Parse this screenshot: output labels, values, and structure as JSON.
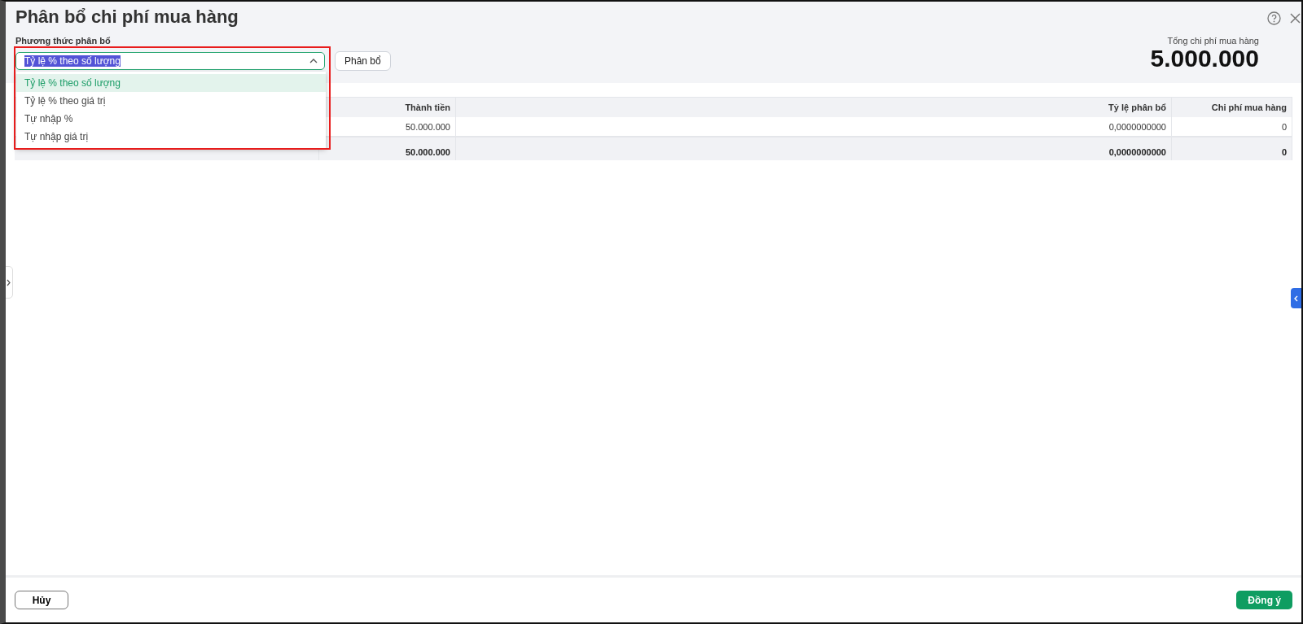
{
  "dialog": {
    "title": "Phân bổ chi phí mua hàng"
  },
  "method": {
    "label": "Phương thức phân bổ",
    "value": "Tỷ lệ % theo số lượng",
    "text_selected": true,
    "expanded": true,
    "options": [
      {
        "label": "Tỷ lệ % theo số lượng",
        "selected": true
      },
      {
        "label": "Tỷ lệ % theo giá trị",
        "selected": false
      },
      {
        "label": "Tự nhập %",
        "selected": false
      },
      {
        "label": "Tự nhập giá trị",
        "selected": false
      }
    ]
  },
  "allocate_button": "Phân bổ",
  "total": {
    "label": "Tổng chi phí mua hàng",
    "value": "5.000.000"
  },
  "table": {
    "columns": [
      "Thành tiền",
      "Tỷ lệ phân bổ",
      "Chi phí mua hàng"
    ],
    "rows": [
      {
        "cells": [
          "50.000.000",
          "0,0000000000",
          "0"
        ]
      }
    ],
    "footer": {
      "cells": [
        "50.000.000",
        "0,0000000000",
        "0"
      ]
    }
  },
  "buttons": {
    "cancel": "Hủy",
    "confirm": "Đồng ý"
  }
}
